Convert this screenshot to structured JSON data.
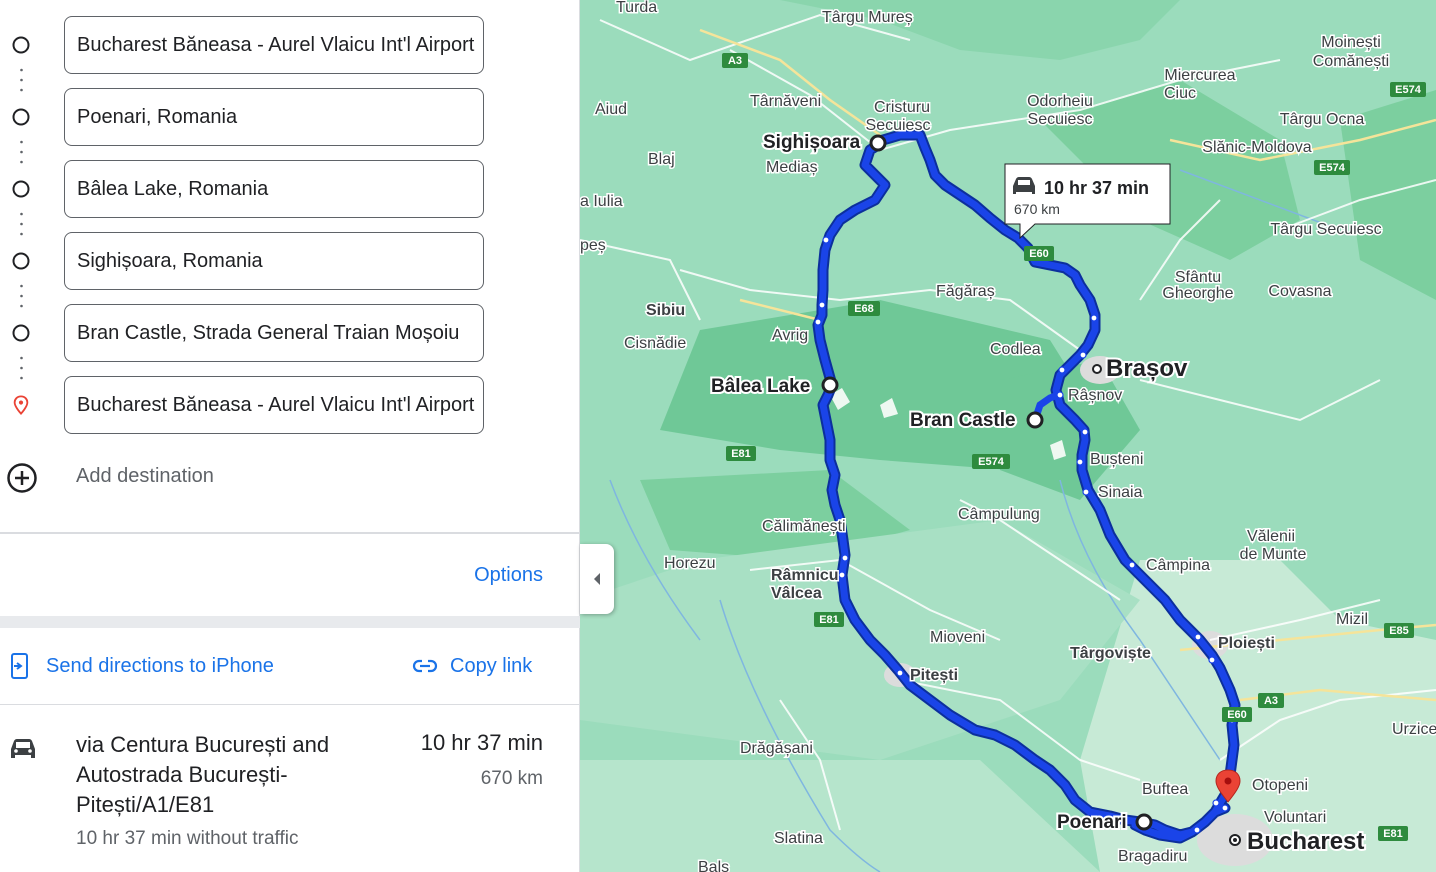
{
  "waypoints": [
    {
      "value": "Bucharest Băneasa - Aurel Vlaicu Int'l Airport",
      "icon": "circle-icon"
    },
    {
      "value": "Poenari, Romania",
      "icon": "circle-icon"
    },
    {
      "value": "Bâlea Lake, Romania",
      "icon": "circle-icon"
    },
    {
      "value": "Sighișoara, Romania",
      "icon": "circle-icon"
    },
    {
      "value": "Bran Castle, Strada General Traian Moșoiu",
      "icon": "circle-icon"
    },
    {
      "value": "Bucharest Băneasa - Aurel Vlaicu Int'l Airport",
      "icon": "destination-pin-icon"
    }
  ],
  "add_destination_label": "Add destination",
  "options_label": "Options",
  "send_directions_label": "Send directions to iPhone",
  "copy_link_label": "Copy link",
  "route": {
    "title": "via Centura București and Autostrada București-Pitești/A1/E81",
    "time": "10 hr 37 min",
    "distance": "670 km",
    "traffic_note": "10 hr 37 min without traffic"
  },
  "map": {
    "tooltip": {
      "time": "10 hr 37 min",
      "distance": "670 km"
    },
    "major_labels": {
      "sighisoara": "Sighișoara",
      "balea": "Bâlea Lake",
      "bran": "Bran Castle",
      "brasov": "Brașov",
      "bucharest": "Bucharest",
      "poenari": "Poenari"
    },
    "places": {
      "turda": "Turda",
      "targu_mures": "Târgu Mureș",
      "moinesti": "Moinești",
      "comanesti": "Comănești",
      "aiud": "Aiud",
      "tarnaveni": "Târnăveni",
      "cristuru": "Cristuru",
      "secuiesc1": "Secuiesc",
      "odorheiu": "Odorheiu",
      "secuiesc2": "Secuiesc",
      "miercurea": "Miercurea",
      "ciuc": "Ciuc",
      "targu_ocna": "Târgu Ocna",
      "blaj": "Blaj",
      "medias": "Mediaș",
      "slanic": "Slănic-Moldova",
      "alba_iulia": "a Iulia",
      "targu_secuiesc": "Târgu Secuiesc",
      "fagaras": "Făgăraș",
      "sfantu": "Sfântu",
      "gheorghe": "Gheorghe",
      "covasna": "Covasna",
      "sibiu": "Sibiu",
      "avrig": "Avrig",
      "cisnadie": "Cisnădie",
      "codlea": "Codlea",
      "rasnov": "Râșnov",
      "busteni": "Bușteni",
      "sinaia": "Sinaia",
      "campulung": "Câmpulung",
      "calimanesti": "Călimănești",
      "horezu": "Horezu",
      "ramnicu": "Râmnicu",
      "valcea": "Vâlcea",
      "valenii": "Vălenii",
      "de_munte": "de Munte",
      "campina": "Câmpina",
      "mioveni": "Mioveni",
      "targoviste": "Târgoviște",
      "ploiesti": "Ploiești",
      "mizil": "Mizil",
      "pitesti": "Pitești",
      "dragasani": "Drăgășani",
      "buftea": "Buftea",
      "otopeni": "Otopeni",
      "voluntari": "Voluntari",
      "urzice": "Urzice",
      "slatina": "Slatina",
      "bragadiru": "Bragadiru",
      "bals": "Balș",
      "pes": "peș"
    },
    "road_shields": {
      "a3_top": "A3",
      "e574_top": "E574",
      "e574_mid": "E574",
      "e60_top": "E60",
      "e68": "E68",
      "e81_left": "E81",
      "e574_bran": "E574",
      "e81_mid": "E81",
      "e85": "E85",
      "a3_bottom": "A3",
      "e60_bottom": "E60",
      "e81_bottom": "E81"
    },
    "colors": {
      "route": "#1a44e8",
      "land": "#8fd8b3",
      "mountain": "#6ec99a",
      "shield": "#2e8b3e",
      "pin": "#ea4335"
    }
  }
}
